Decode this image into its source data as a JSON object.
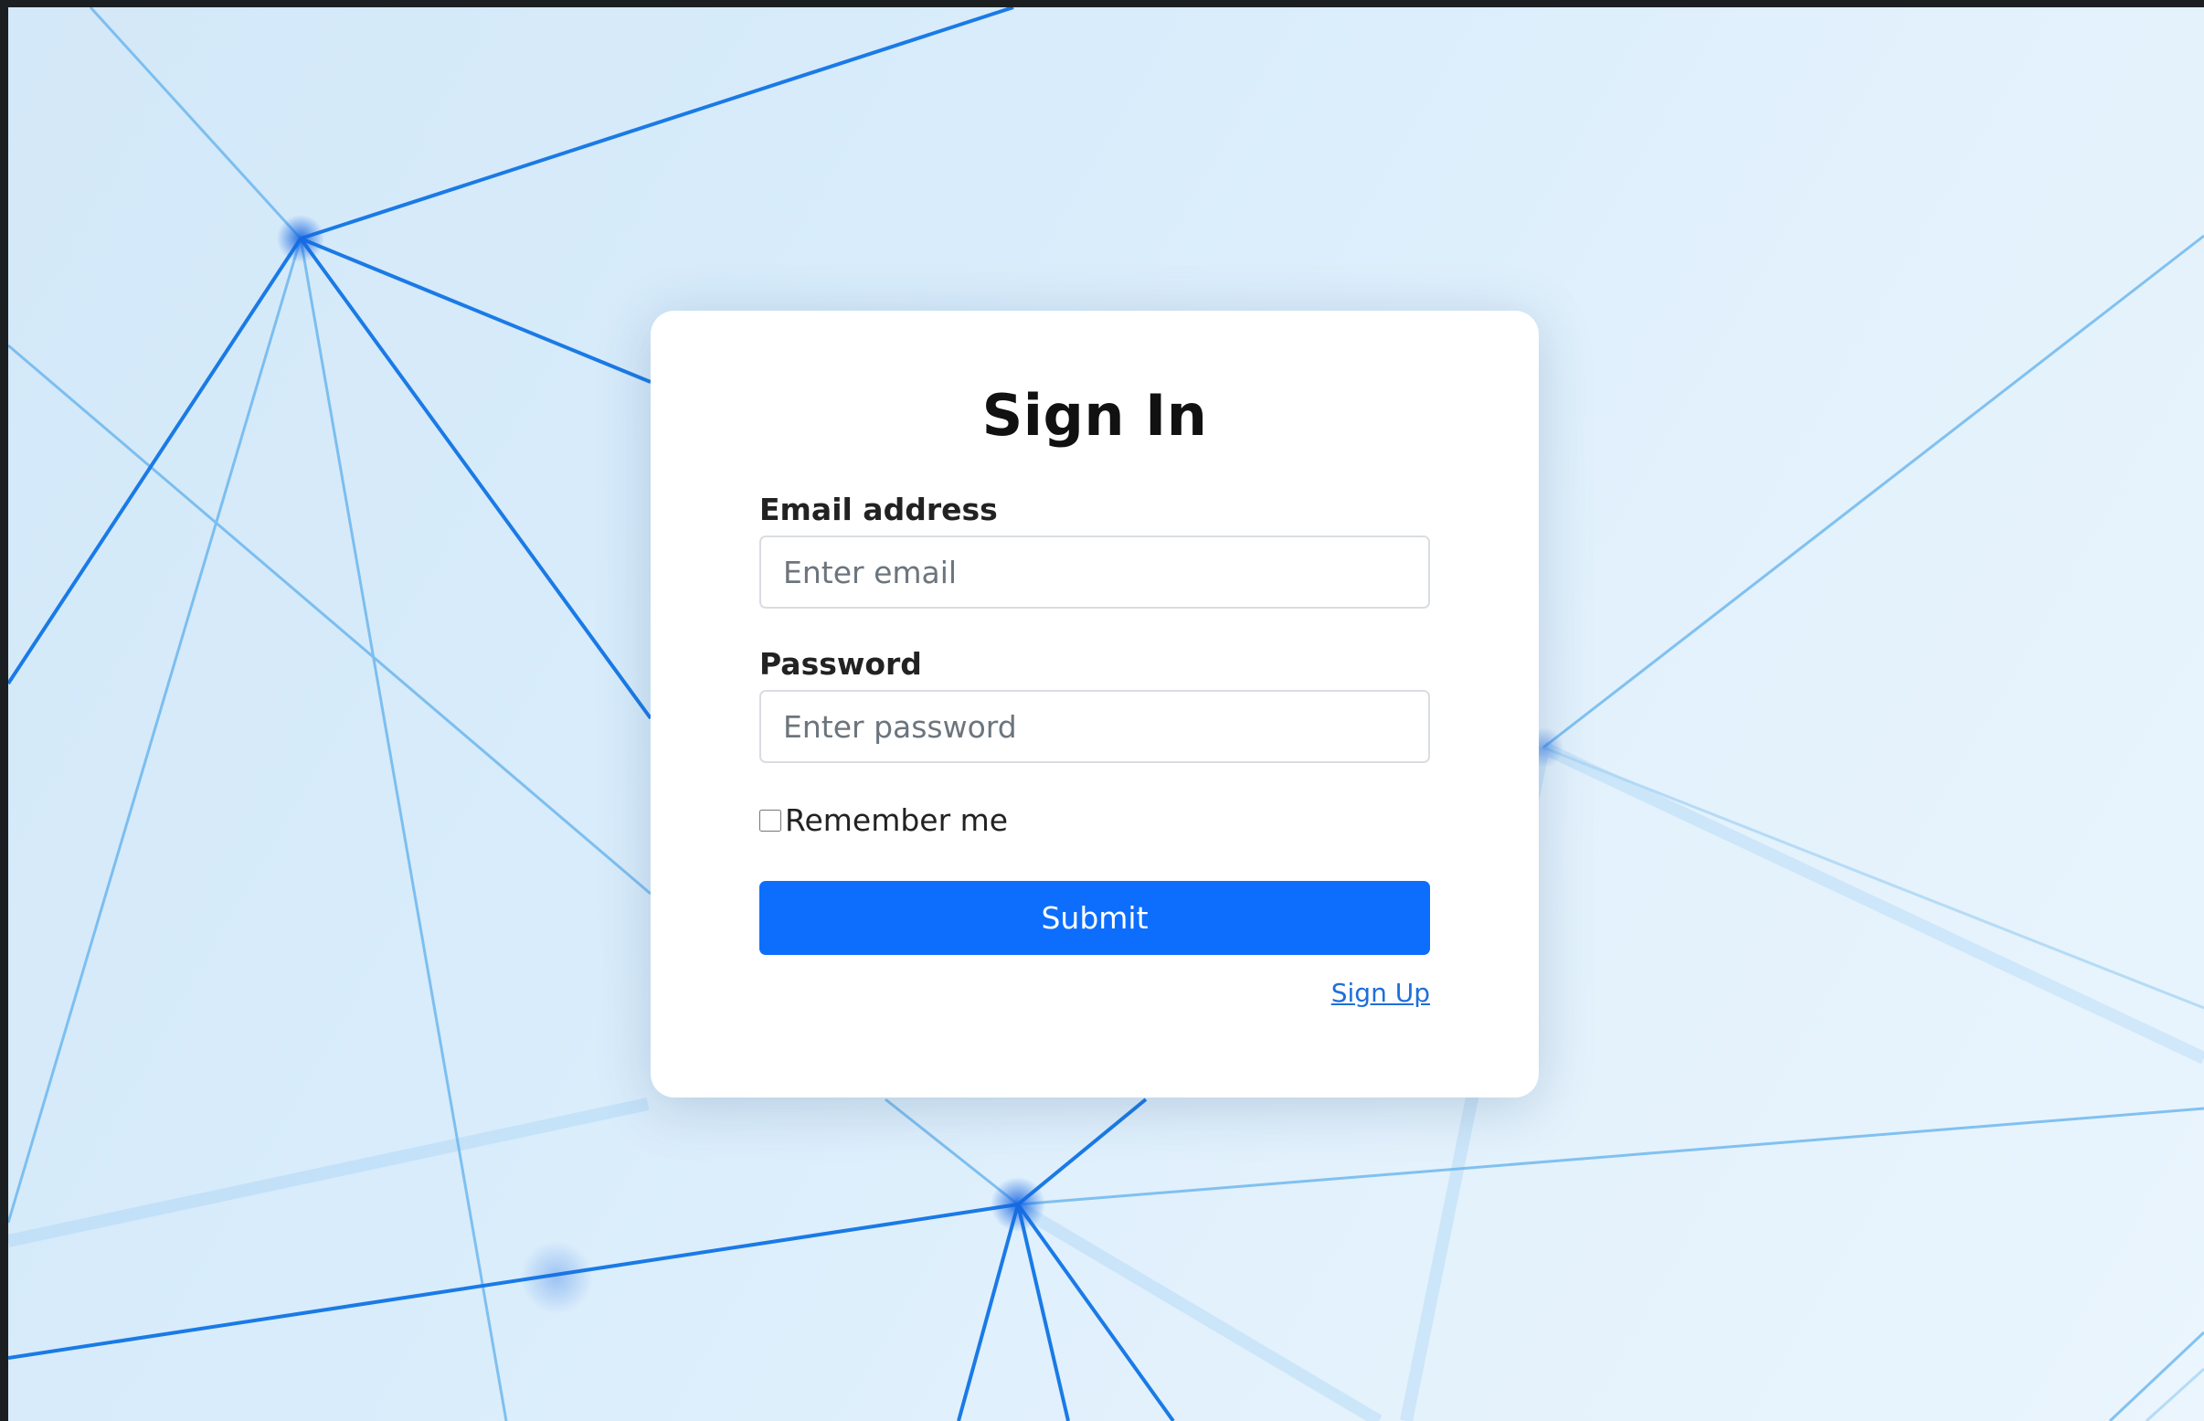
{
  "colors": {
    "background": "#d8ecfb",
    "accent": "#0d6efd",
    "line": "#1a7ae6",
    "card": "#ffffff"
  },
  "form": {
    "title": "Sign In",
    "email_label": "Email address",
    "email_placeholder": "Enter email",
    "email_value": "",
    "password_label": "Password",
    "password_placeholder": "Enter password",
    "password_value": "",
    "remember_label": "Remember me",
    "remember_checked": false,
    "submit_label": "Submit",
    "signup_label": "Sign Up"
  }
}
